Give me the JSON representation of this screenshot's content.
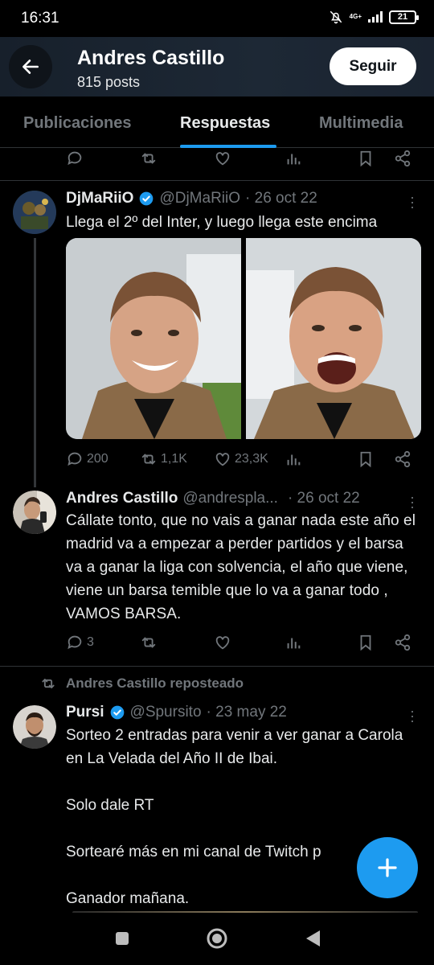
{
  "status_bar": {
    "time": "16:31",
    "network": "4G+",
    "battery": "21"
  },
  "header": {
    "name": "Andres Castillo",
    "posts": "815 posts",
    "follow_label": "Seguir"
  },
  "tabs": [
    {
      "label": "Publicaciones",
      "active": false
    },
    {
      "label": "Respuestas",
      "active": true
    },
    {
      "label": "Multimedia",
      "active": false
    }
  ],
  "tweets": [
    {
      "name": "DjMaRiiO",
      "verified": true,
      "handle": "@DjMaRiiO",
      "date": "· 26 oct 22",
      "text": "Llega el 2º del Inter, y luego llega este encima",
      "replies": "200",
      "retweets": "1,1K",
      "likes": "23,3K"
    },
    {
      "name": "Andres Castillo",
      "handle": "@andrespla...",
      "date": "· 26 oct 22",
      "text": "Cállate tonto, que no vais a ganar nada este año el madrid va a empezar a perder partidos y el barsa va a ganar la liga con solvencia, el año que viene, viene un barsa temible que lo va a ganar todo , VAMOS BARSA.",
      "replies": "3"
    },
    {
      "repost_label": "Andres Castillo reposteado",
      "name": "Pursi",
      "verified": true,
      "handle": "@Spursito",
      "date": "· 23 may 22",
      "text": "Sorteo 2 entradas para venir a ver ganar a Carola en La Velada del Año II de Ibai.\n\nSolo dale RT\n\nSortearé más en mi canal de Twitch p\n\nGanador mañana."
    }
  ],
  "colors": {
    "accent": "#1d9bf0",
    "background": "#000000",
    "muted": "#71767b"
  }
}
